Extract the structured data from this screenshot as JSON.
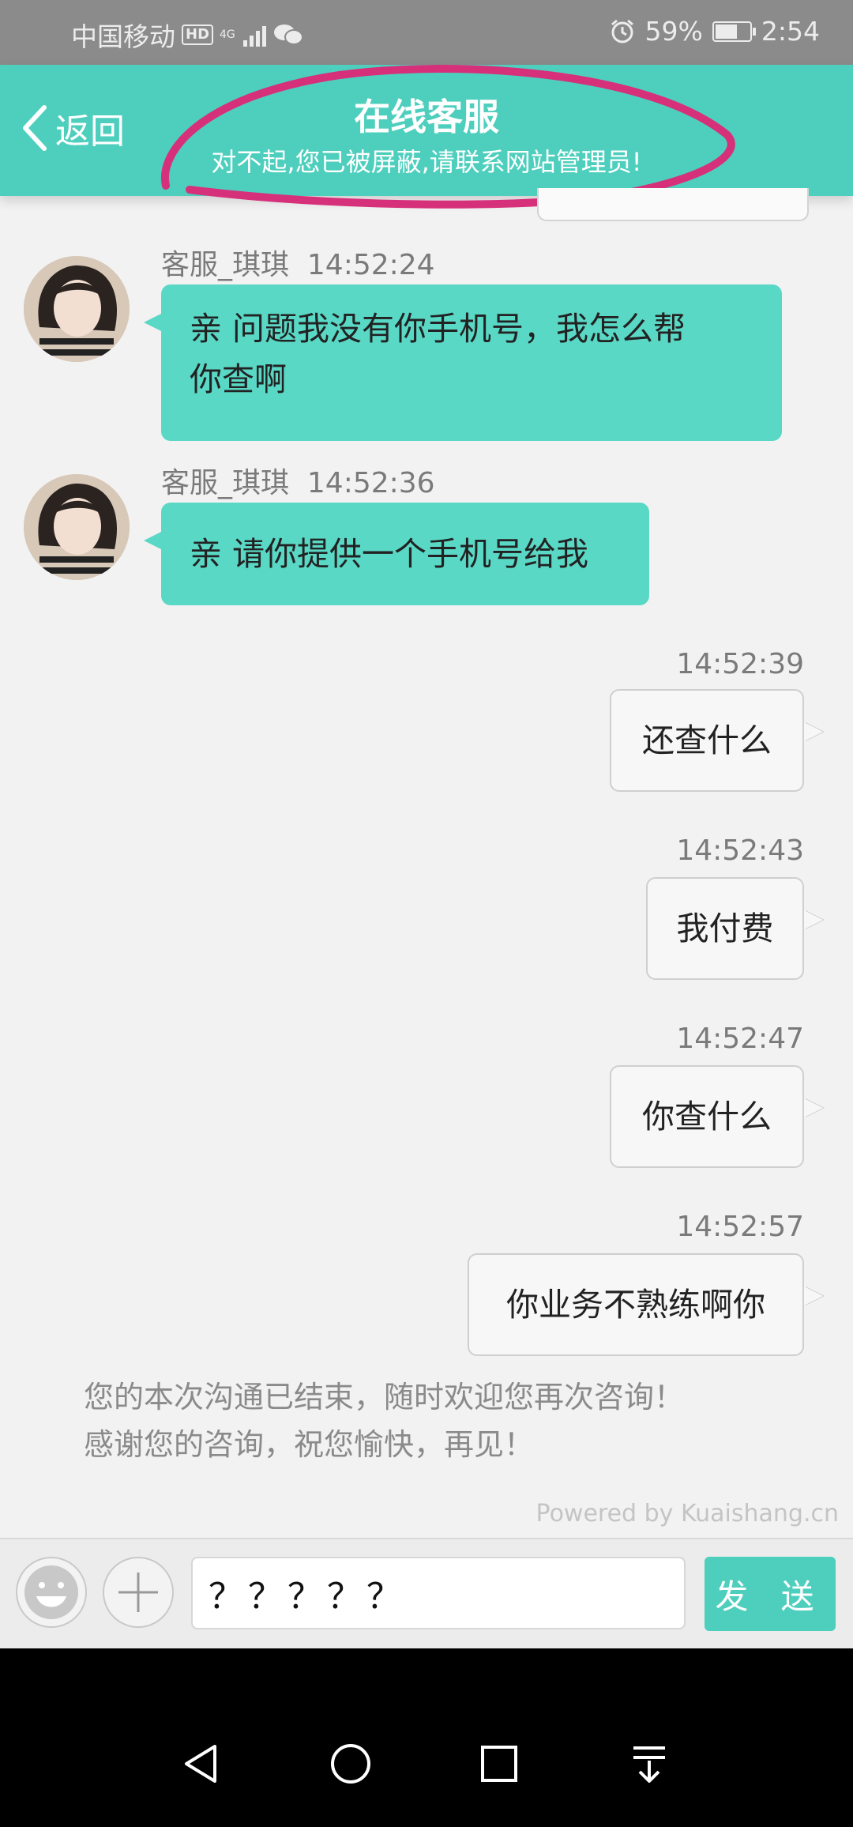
{
  "status_bar": {
    "carrier": "中国移动",
    "hd": "HD",
    "network": "4G",
    "battery_percent": "59%",
    "battery_level": 0.59,
    "time": "2:54",
    "icons": [
      "hd-icon",
      "signal-icon",
      "wechat-icon",
      "alarm-icon",
      "battery-icon"
    ]
  },
  "header": {
    "back_label": "返回",
    "title": "在线客服",
    "subtitle": "对不起,您已被屏蔽,请联系网站管理员!"
  },
  "messages": [
    {
      "direction": "in",
      "sender": "客服_琪琪",
      "time": "14:52:24",
      "text_lines": [
        "亲 问题我没有你手机号，我怎么帮",
        "你查啊"
      ]
    },
    {
      "direction": "in",
      "sender": "客服_琪琪",
      "time": "14:52:36",
      "text": "亲 请你提供一个手机号给我"
    },
    {
      "direction": "out",
      "time": "14:52:39",
      "text": "还查什么"
    },
    {
      "direction": "out",
      "time": "14:52:43",
      "text": "我付费"
    },
    {
      "direction": "out",
      "time": "14:52:47",
      "text": "你查什么"
    },
    {
      "direction": "out",
      "time": "14:52:57",
      "text": "你业务不熟练啊你"
    }
  ],
  "end_note": {
    "line1": "您的本次沟通已结束，随时欢迎您再次咨询！",
    "line2": "感谢您的咨询，祝您愉快，再见！"
  },
  "powered_by": "Powered by Kuaishang.cn",
  "input": {
    "value": "？？？？？",
    "send_label": "发 送"
  },
  "colors": {
    "accent": "#4ecfbd",
    "bubble_in": "#5ad8c6",
    "annotation": "#d6307a"
  }
}
